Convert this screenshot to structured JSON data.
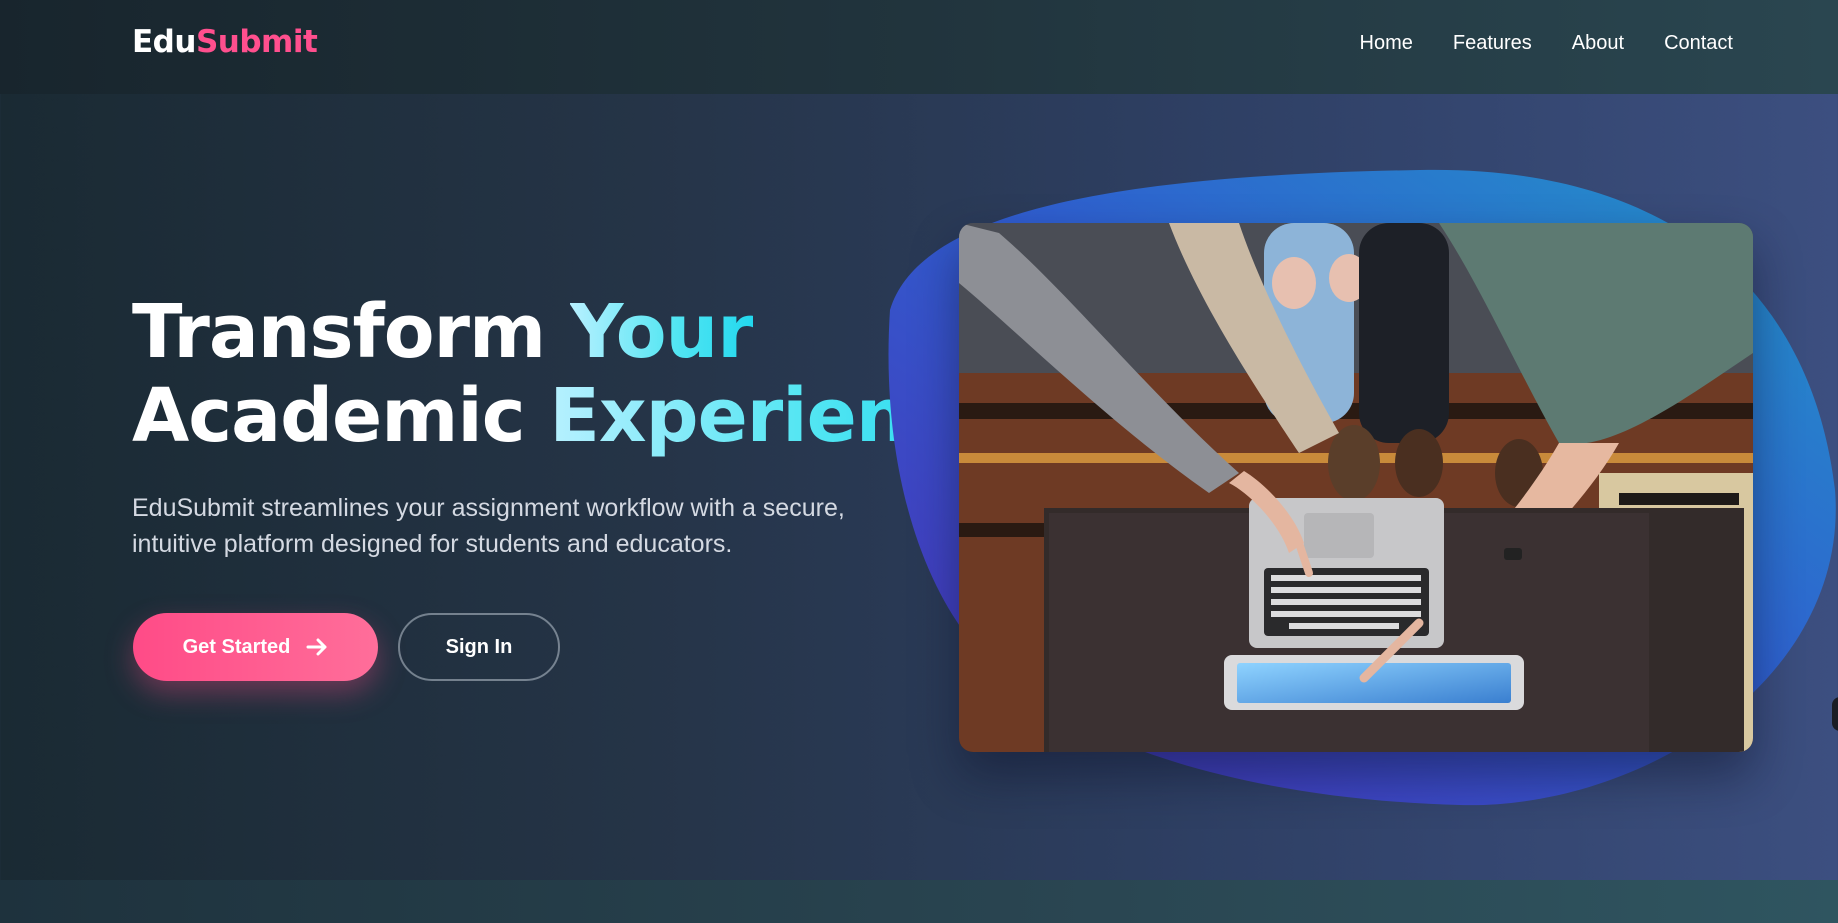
{
  "brand": {
    "part1": "Edu",
    "part2": "Submit"
  },
  "nav": {
    "items": [
      {
        "label": "Home"
      },
      {
        "label": "Features"
      },
      {
        "label": "About"
      },
      {
        "label": "Contact"
      }
    ]
  },
  "hero": {
    "line1_white": "Transform ",
    "line1_accent": "Your",
    "line2_white": "Academic ",
    "line2_accent": "Experience",
    "description": "EduSubmit streamlines your assignment workflow with a secure, intuitive platform designed for students and educators.",
    "primary_button": "Get Started",
    "secondary_button": "Sign In"
  },
  "colors": {
    "brand_pink": "#ff4f8e",
    "accent_cyan": "#22d8ee",
    "blob_blue": "#2a78c8",
    "blob_purple": "#4a2fb8"
  },
  "icons": {
    "primary_button_icon": "arrow-right-icon"
  }
}
